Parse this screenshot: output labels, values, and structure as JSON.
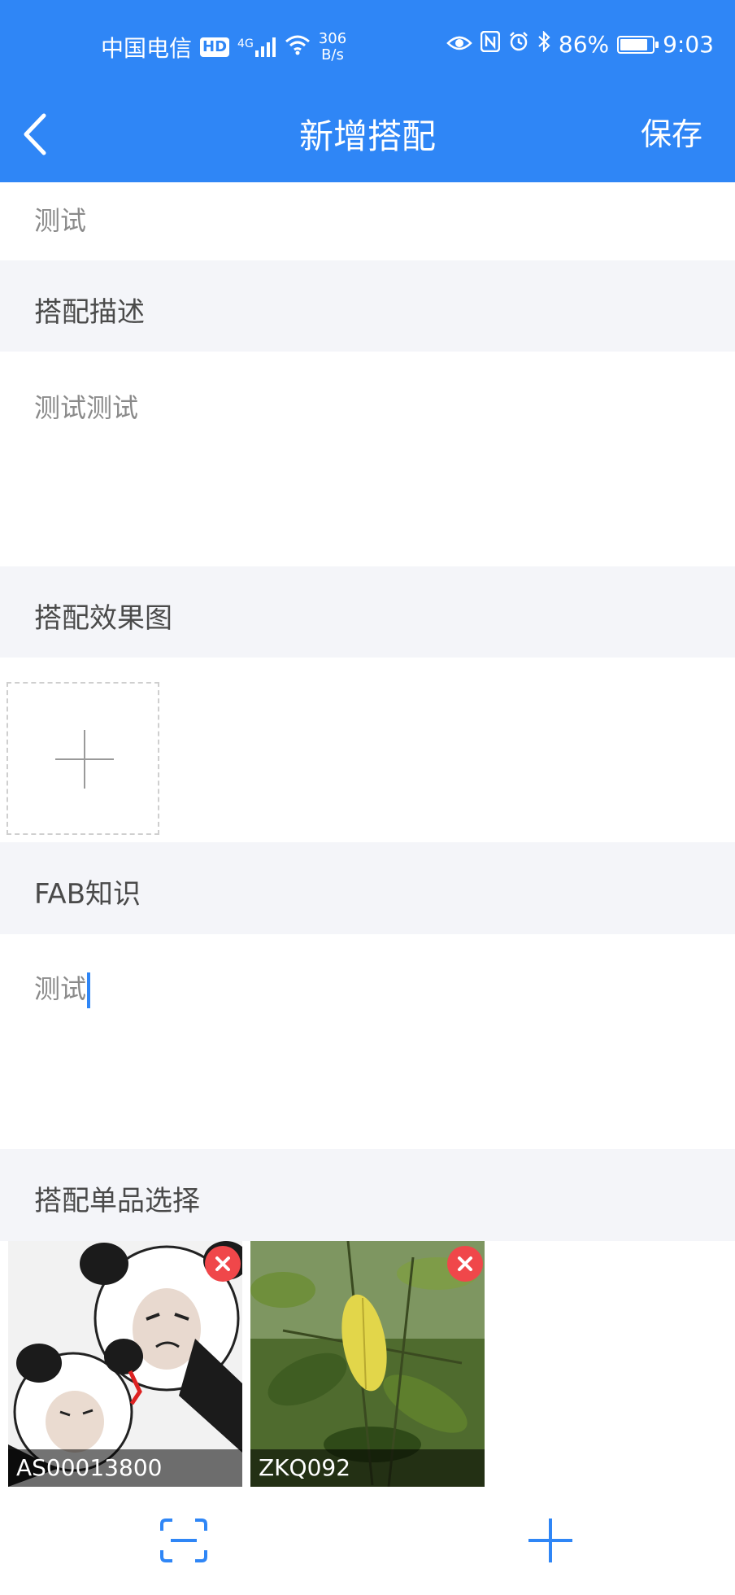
{
  "status_bar": {
    "carrier": "中国电信",
    "hd_badge": "HD",
    "network_type": "4G",
    "net_speed_value": "306",
    "net_speed_unit": "B/s",
    "battery": "86%",
    "battery_level": 0.86,
    "time": "9:03"
  },
  "nav": {
    "title": "新增搭配",
    "save_label": "保存"
  },
  "form": {
    "name_value": "测试",
    "description_label": "搭配描述",
    "description_value": "测试测试",
    "effect_image_label": "搭配效果图",
    "fab_label": "FAB知识",
    "fab_value": "测试",
    "items_label": "搭配单品选择"
  },
  "selected_items": [
    {
      "code": "AS00013800"
    },
    {
      "code": "ZKQ092"
    }
  ],
  "colors": {
    "accent": "#2f86f6",
    "section_bg": "#f4f5f9",
    "remove": "#f0474a"
  }
}
